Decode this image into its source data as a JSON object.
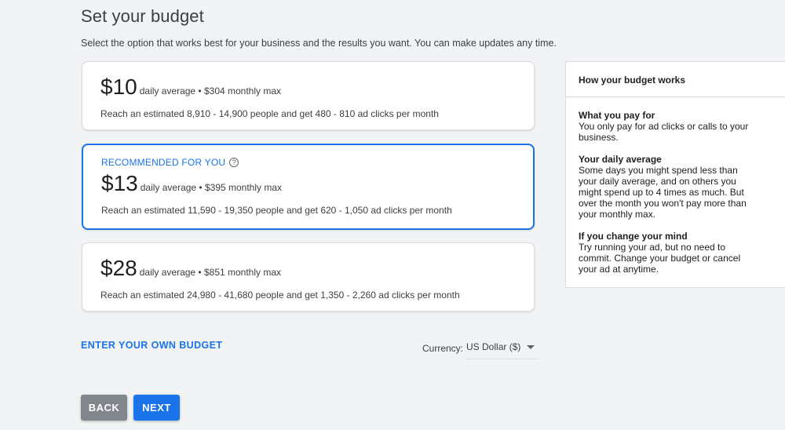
{
  "header": {
    "title": "Set your budget",
    "subtitle": "Select the option that works best for your business and the results you want. You can make updates any time."
  },
  "options": [
    {
      "label": "",
      "price": "$10",
      "detail": "daily average • $304 monthly max",
      "reach": "Reach an estimated 8,910 - 14,900 people and get 480 - 810 ad clicks per month",
      "selected": false
    },
    {
      "label": "RECOMMENDED FOR YOU",
      "price": "$13",
      "detail": "daily average • $395 monthly max",
      "reach": "Reach an estimated 11,590 - 19,350 people and get 620 - 1,050 ad clicks per month",
      "selected": true
    },
    {
      "label": "",
      "price": "$28",
      "detail": "daily average • $851 monthly max",
      "reach": "Reach an estimated 24,980 - 41,680 people and get 1,350 - 2,260 ad clicks per month",
      "selected": false
    }
  ],
  "own_budget_label": "ENTER YOUR OWN BUDGET",
  "currency": {
    "label": "Currency:",
    "value": "US Dollar ($)"
  },
  "buttons": {
    "back": "BACK",
    "next": "NEXT"
  },
  "info": {
    "header": "How your budget works",
    "sections": [
      {
        "title": "What you pay for",
        "text": "You only pay for ad clicks or calls to your business."
      },
      {
        "title": "Your daily average",
        "text": "Some days you might spend less than your daily average, and on others you might spend up to 4 times as much. But over the month you won't pay more than your monthly max."
      },
      {
        "title": "If you change your mind",
        "text": "Try running your ad, but no need to commit. Change your budget or cancel your ad at anytime."
      }
    ]
  },
  "icons": {
    "help": "help-circle-icon",
    "dropdown": "caret-down-icon"
  },
  "colors": {
    "accent": "#1a73e8",
    "background": "#f1f3f4",
    "back_button": "#80868b"
  }
}
